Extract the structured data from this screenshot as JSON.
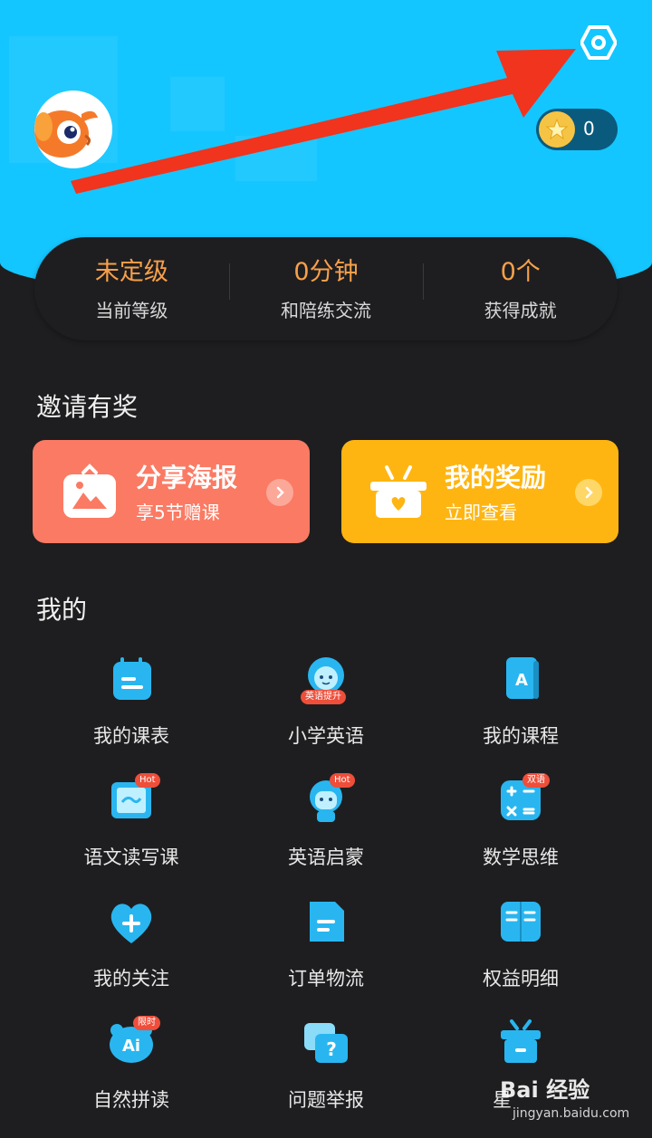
{
  "header": {
    "coin_count": "0",
    "accent": "#14c6ff"
  },
  "stats": [
    {
      "value": "未定级",
      "label": "当前等级"
    },
    {
      "value": "0分钟",
      "label": "和陪练交流"
    },
    {
      "value": "0个",
      "label": "获得成就"
    }
  ],
  "invite": {
    "title": "邀请有奖",
    "share": {
      "title": "分享海报",
      "subtitle": "享5节赠课",
      "color": "#fb7a63"
    },
    "reward": {
      "title": "我的奖励",
      "subtitle": "立即查看",
      "color": "#ffb511"
    }
  },
  "mine": {
    "title": "我的",
    "items": [
      {
        "label": "我的课表",
        "icon": "calendar-icon"
      },
      {
        "label": "小学英语",
        "icon": "kid-avatar-icon",
        "badge": "英语提升"
      },
      {
        "label": "我的课程",
        "icon": "book-icon"
      },
      {
        "label": "语文读写课",
        "icon": "scroll-icon",
        "badge": "Hot"
      },
      {
        "label": "英语启蒙",
        "icon": "child-avatar-icon",
        "badge": "Hot"
      },
      {
        "label": "数学思维",
        "icon": "math-icon",
        "badge": "双语"
      },
      {
        "label": "我的关注",
        "icon": "heart-plus-icon"
      },
      {
        "label": "订单物流",
        "icon": "document-icon"
      },
      {
        "label": "权益明细",
        "icon": "open-book-icon"
      },
      {
        "label": "自然拼读",
        "icon": "ai-bear-icon",
        "badge": "限时"
      },
      {
        "label": "问题举报",
        "icon": "question-icon"
      },
      {
        "label": "星",
        "icon": "gift-box-icon"
      }
    ]
  },
  "watermark": {
    "logo": "Bai 经验",
    "url": "jingyan.baidu.com"
  }
}
